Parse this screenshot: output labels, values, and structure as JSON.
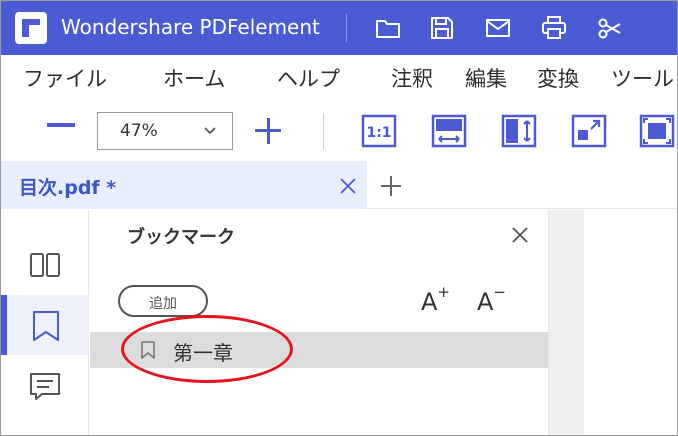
{
  "app": {
    "title": "Wondershare PDFelement",
    "accent_color": "#4a5bd4",
    "titlebar_icons": [
      "folder-icon",
      "save-icon",
      "mail-icon",
      "print-icon",
      "scissors-icon"
    ]
  },
  "menu": {
    "items": [
      "ファイル",
      "ホーム",
      "ヘルプ",
      "注釈",
      "編集",
      "変換",
      "ツール"
    ]
  },
  "toolbar": {
    "zoom_value": "47%",
    "view_icons": [
      "actual-size-icon",
      "fit-width-icon",
      "fit-height-icon",
      "fit-page-icon",
      "full-screen-icon"
    ]
  },
  "tabs": [
    {
      "title": "目次.pdf *"
    }
  ],
  "sidebar": {
    "icons": [
      "thumbnails-icon",
      "bookmark-icon",
      "comment-icon"
    ],
    "active": "bookmark-icon"
  },
  "bookmark_panel": {
    "title": "ブックマーク",
    "add_label": "追加",
    "font_increase": {
      "letter": "A",
      "symbol": "+"
    },
    "font_decrease": {
      "letter": "A",
      "symbol": "−"
    },
    "items": [
      {
        "label": "第一章"
      }
    ],
    "annotation_color": "#e8141c"
  }
}
